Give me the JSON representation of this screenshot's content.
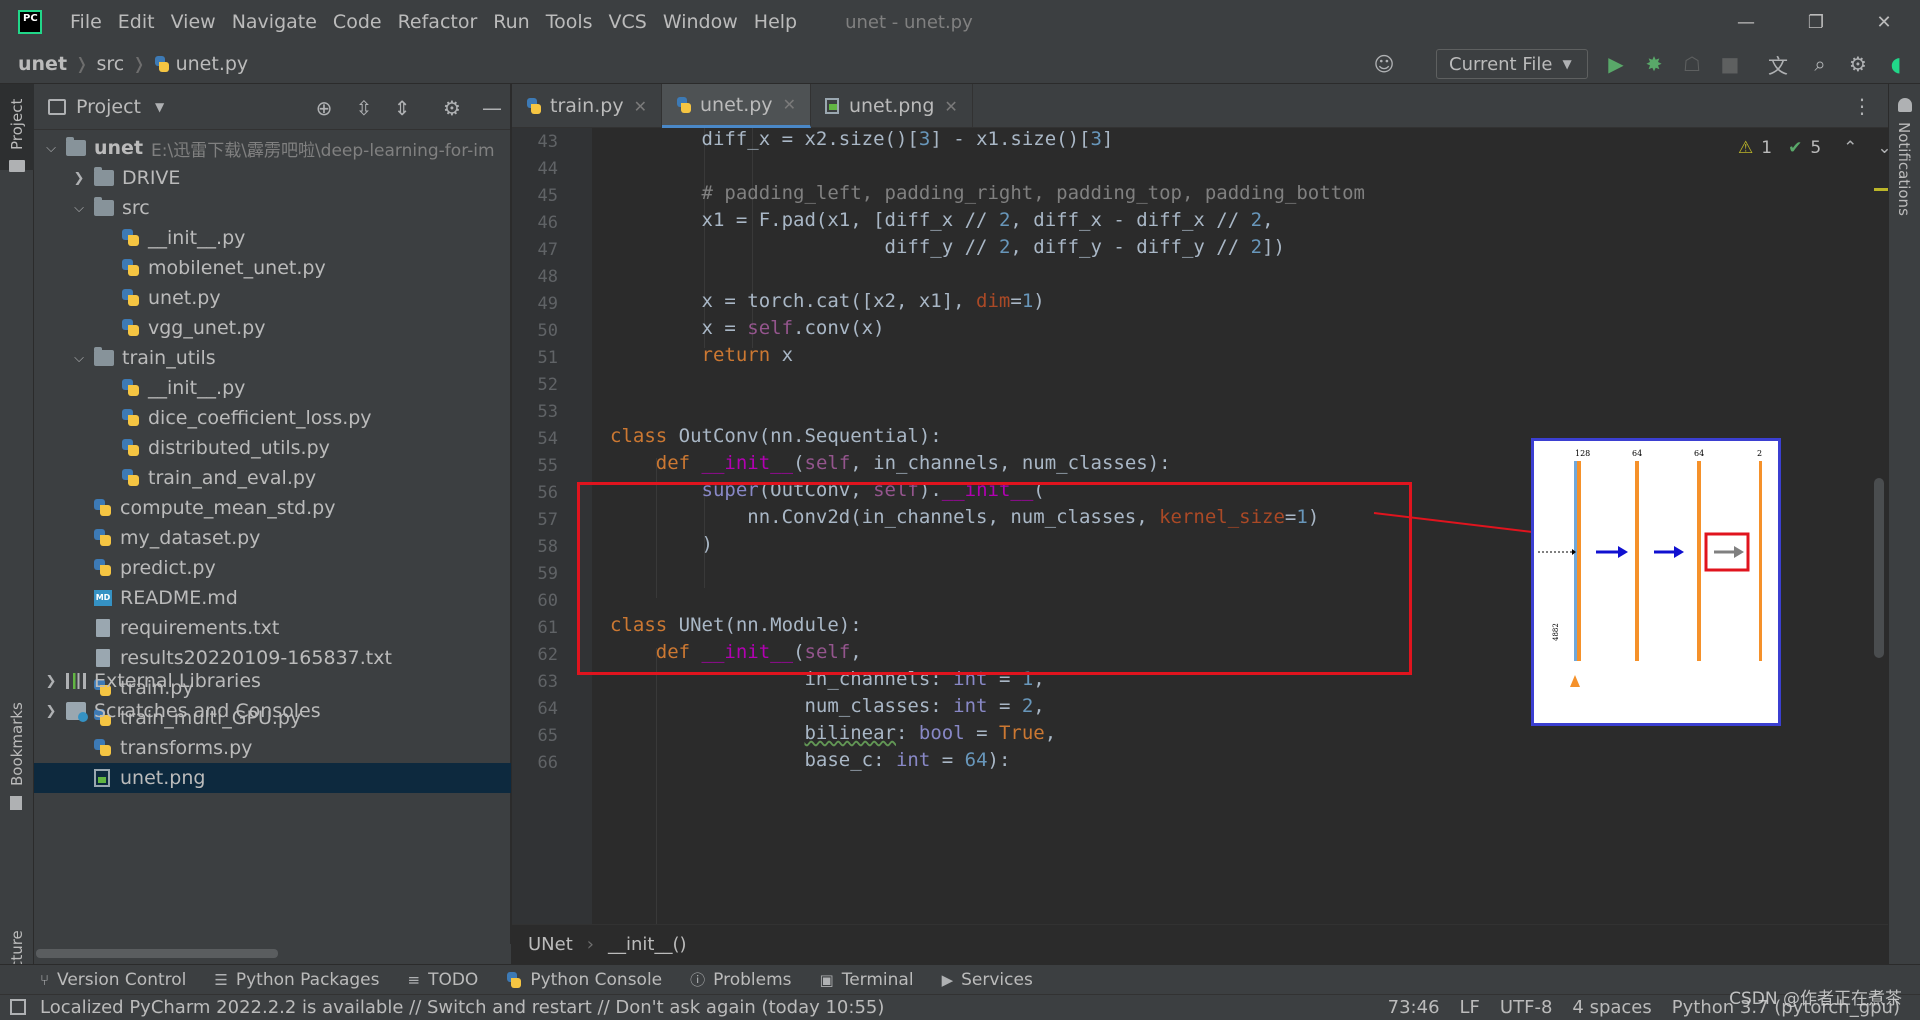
{
  "app": {
    "window_title": "unet - unet.py",
    "logo_text": "PC"
  },
  "menu": [
    "File",
    "Edit",
    "View",
    "Navigate",
    "Code",
    "Refactor",
    "Run",
    "Tools",
    "VCS",
    "Window",
    "Help"
  ],
  "navbar": {
    "crumbs": [
      "unet",
      "src",
      "unet.py"
    ],
    "run_config": "Current File"
  },
  "project_panel": {
    "title": "Project",
    "root": {
      "name": "unet",
      "path": "E:\\迅雷下载\\霹雳吧啦\\deep-learning-for-im"
    },
    "items": [
      {
        "label": "DRIVE",
        "type": "folder",
        "depth": 1,
        "expanded": false
      },
      {
        "label": "src",
        "type": "folder",
        "depth": 1,
        "expanded": true
      },
      {
        "label": "__init__.py",
        "type": "py",
        "depth": 2
      },
      {
        "label": "mobilenet_unet.py",
        "type": "py",
        "depth": 2
      },
      {
        "label": "unet.py",
        "type": "py",
        "depth": 2
      },
      {
        "label": "vgg_unet.py",
        "type": "py",
        "depth": 2
      },
      {
        "label": "train_utils",
        "type": "folder",
        "depth": 1,
        "expanded": true
      },
      {
        "label": "__init__.py",
        "type": "py",
        "depth": 2
      },
      {
        "label": "dice_coefficient_loss.py",
        "type": "py",
        "depth": 2
      },
      {
        "label": "distributed_utils.py",
        "type": "py",
        "depth": 2
      },
      {
        "label": "train_and_eval.py",
        "type": "py",
        "depth": 2
      },
      {
        "label": "compute_mean_std.py",
        "type": "py",
        "depth": 1
      },
      {
        "label": "my_dataset.py",
        "type": "py",
        "depth": 1
      },
      {
        "label": "predict.py",
        "type": "py",
        "depth": 1
      },
      {
        "label": "README.md",
        "type": "md",
        "depth": 1
      },
      {
        "label": "requirements.txt",
        "type": "txt",
        "depth": 1
      },
      {
        "label": "results20220109-165837.txt",
        "type": "txt",
        "depth": 1
      },
      {
        "label": "train.py",
        "type": "py",
        "depth": 1
      },
      {
        "label": "train_multi_GPU.py",
        "type": "py",
        "depth": 1
      },
      {
        "label": "transforms.py",
        "type": "py",
        "depth": 1
      },
      {
        "label": "unet.png",
        "type": "png",
        "depth": 1,
        "selected": true
      }
    ],
    "external_libraries": "External Libraries",
    "scratches": "Scratches and Consoles"
  },
  "side_labels": {
    "project": "Project",
    "bookmarks": "Bookmarks",
    "structure": "Structure",
    "notifications": "Notifications"
  },
  "tabs": [
    {
      "label": "train.py",
      "type": "py",
      "active": false
    },
    {
      "label": "unet.py",
      "type": "py",
      "active": true
    },
    {
      "label": "unet.png",
      "type": "png",
      "active": false
    }
  ],
  "inspection": {
    "warnings": "1",
    "ok": "5"
  },
  "code": {
    "line_numbers": [
      "43",
      "44",
      "45",
      "46",
      "47",
      "48",
      "49",
      "50",
      "51",
      "52",
      "53",
      "54",
      "55",
      "56",
      "57",
      "58",
      "59",
      "60",
      "61",
      "62",
      "63",
      "64",
      "65",
      "66"
    ]
  },
  "thumbnail": {
    "labels": [
      "128",
      "64",
      "64",
      "2"
    ],
    "side_label": "4882"
  },
  "editor_breadcrumb": [
    "UNet",
    "__init__()"
  ],
  "bottom_tools": [
    {
      "label": "Version Control",
      "icon": "branch-icon"
    },
    {
      "label": "Python Packages",
      "icon": "layers-icon"
    },
    {
      "label": "TODO",
      "icon": "list-icon"
    },
    {
      "label": "Python Console",
      "icon": "python-icon"
    },
    {
      "label": "Problems",
      "icon": "info-icon"
    },
    {
      "label": "Terminal",
      "icon": "terminal-icon"
    },
    {
      "label": "Services",
      "icon": "play-circle-icon"
    }
  ],
  "status": {
    "message": "Localized PyCharm 2022.2.2 is available // Switch and restart // Don't ask again (today 10:55)",
    "position": "73:46",
    "line_sep": "LF",
    "encoding": "UTF-8",
    "indent": "4 spaces",
    "interpreter": "Python 3.7 (pytorch_gpu)"
  },
  "watermark": "CSDN @作者正在煮茶",
  "colors": {
    "highlight_box": "#e0141e",
    "thumbnail_border": "#3b3fd1",
    "selection": "#0d293e"
  }
}
